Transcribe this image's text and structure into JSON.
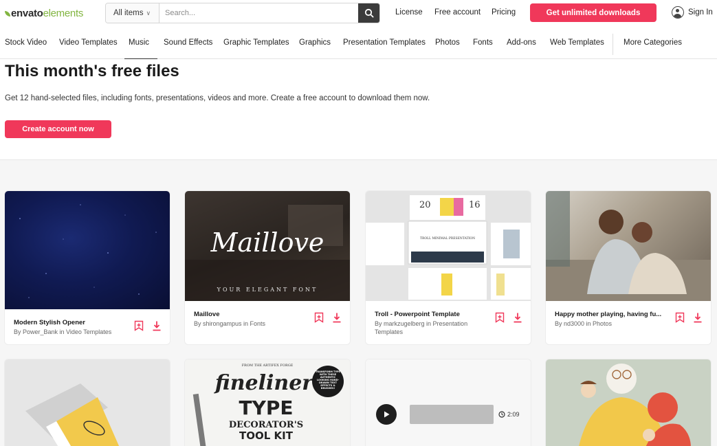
{
  "brand": {
    "part1": "envato",
    "part2": "elements",
    "accent": "#82b541"
  },
  "search": {
    "scope": "All items",
    "placeholder": "Search..."
  },
  "top_links": {
    "license": "License",
    "free_account": "Free account",
    "pricing": "Pricing"
  },
  "cta_label": "Get unlimited downloads",
  "signin_label": "Sign In",
  "categories": [
    "Stock Video",
    "Video Templates",
    "Music",
    "Sound Effects",
    "Graphic Templates",
    "Graphics",
    "Presentation Templates",
    "Photos",
    "Fonts",
    "Add-ons",
    "Web Templates",
    "More Categories"
  ],
  "active_category": "Music",
  "hero": {
    "title": "This month's free files",
    "description": "Get 12 hand-selected files, including fonts, presentations, videos and more. Create a free account to download them now.",
    "button": "Create account now"
  },
  "cards": [
    {
      "title": "Modern Stylish Opener",
      "meta": "By Power_Bank in Video Templates"
    },
    {
      "title": "Maillove",
      "meta": "By shirongampus in Fonts",
      "art_text": "Maillove",
      "art_sub": "YOUR ELEGANT FONT"
    },
    {
      "title": "Troll - Powerpoint Template",
      "meta": "By markzugelberg in Presentation Templates",
      "art_year_a": "20",
      "art_year_b": "16",
      "art_sub": "TROLL MINIMAL PRESENTATION"
    },
    {
      "title": "Happy mother playing, having fu...",
      "meta": "By nd3000 in Photos"
    }
  ],
  "row2": {
    "fineliner_top": "FROM THE ARTIFEX FORGE",
    "fineliner_line1": "fineliner",
    "fineliner_line2": "TYPE",
    "fineliner_line3": "DECORATOR'S",
    "fineliner_line4": "TOOL KIT",
    "fineliner_badge": "TRANSFORM TYPE WITH THESE AUTHENTIC LOOKING HAND-DRAWN TEXT EFFECTS & BRUSHES!",
    "audio_duration": "2:09"
  },
  "colors": {
    "primary": "#f0385a",
    "dark": "#3b3b3b"
  }
}
